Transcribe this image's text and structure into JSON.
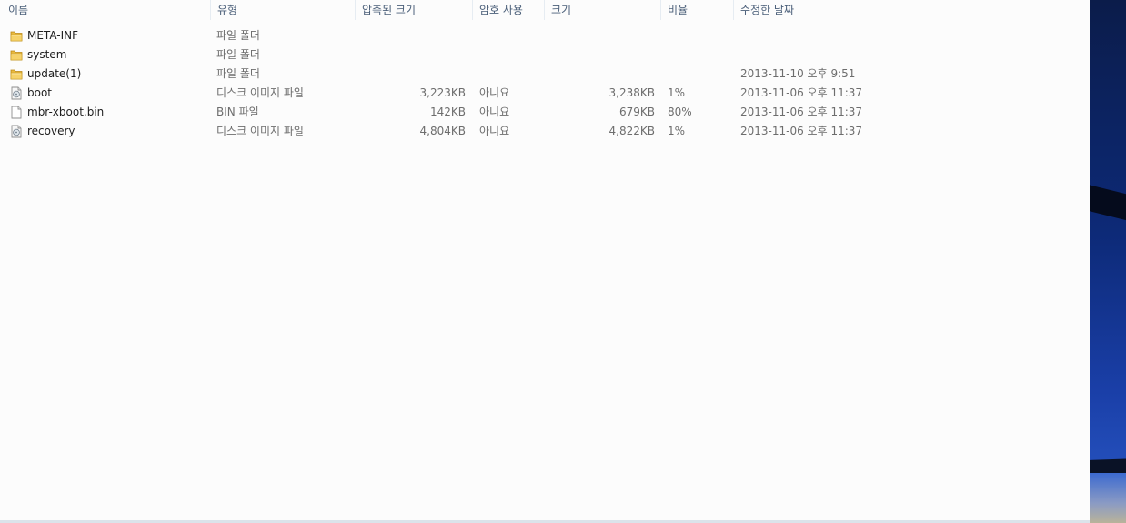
{
  "columns": {
    "name": "이름",
    "type": "유형",
    "compressed": "압축된 크기",
    "encrypted": "암호 사용",
    "size": "크기",
    "ratio": "비율",
    "modified": "수정한 날짜"
  },
  "files": [
    {
      "name": "META-INF",
      "icon": "folder-icon",
      "type": "파일 폴더",
      "compressed": "",
      "encrypted": "",
      "size": "",
      "ratio": "",
      "modified": ""
    },
    {
      "name": "system",
      "icon": "folder-icon",
      "type": "파일 폴더",
      "compressed": "",
      "encrypted": "",
      "size": "",
      "ratio": "",
      "modified": ""
    },
    {
      "name": "update(1)",
      "icon": "folder-icon",
      "type": "파일 폴더",
      "compressed": "",
      "encrypted": "",
      "size": "",
      "ratio": "",
      "modified": "2013-11-10 오후 9:51"
    },
    {
      "name": "boot",
      "icon": "disc-image-icon",
      "type": "디스크 이미지 파일",
      "compressed": "3,223KB",
      "encrypted": "아니요",
      "size": "3,238KB",
      "ratio": "1%",
      "modified": "2013-11-06 오후 11:37"
    },
    {
      "name": "mbr-xboot.bin",
      "icon": "file-icon",
      "type": "BIN 파일",
      "compressed": "142KB",
      "encrypted": "아니요",
      "size": "679KB",
      "ratio": "80%",
      "modified": "2013-11-06 오후 11:37"
    },
    {
      "name": "recovery",
      "icon": "disc-image-icon",
      "type": "디스크 이미지 파일",
      "compressed": "4,804KB",
      "encrypted": "아니요",
      "size": "4,822KB",
      "ratio": "1%",
      "modified": "2013-11-06 오후 11:37"
    }
  ]
}
